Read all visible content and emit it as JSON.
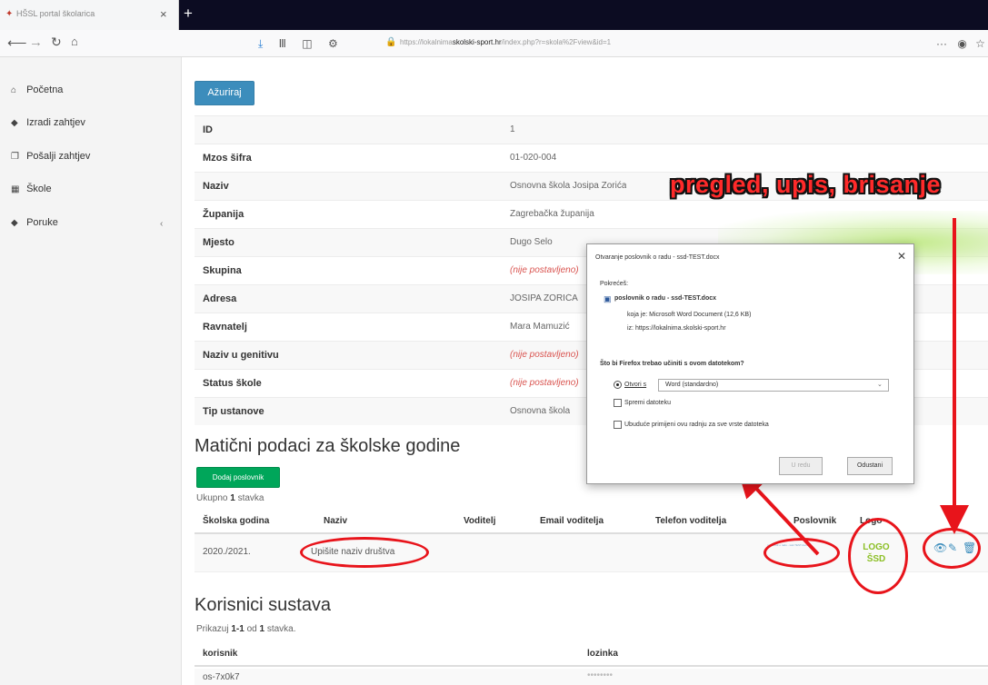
{
  "browser": {
    "tab_title": "HŠSL portal školarica",
    "url_prefix": "https://lokalnima",
    "url_domain": "skolski-sport.hr",
    "url_suffix": "/index.php?r=skola%2Fview&id=1",
    "overflow": "···"
  },
  "sidebar": {
    "items": [
      {
        "label": "Početna",
        "icon": "home-icon"
      },
      {
        "label": "Izradi zahtjev",
        "icon": "tag-icon"
      },
      {
        "label": "Pošalji zahtjev",
        "icon": "copy-icon"
      },
      {
        "label": "Škole",
        "icon": "building-icon"
      },
      {
        "label": "Poruke",
        "icon": "tag-icon"
      }
    ]
  },
  "main": {
    "update_button": "Ažuriraj",
    "details": [
      {
        "label": "ID",
        "value": "1",
        "notset": false
      },
      {
        "label": "Mzos šifra",
        "value": "01-020-004",
        "notset": false
      },
      {
        "label": "Naziv",
        "value": "Osnovna škola Josipa Zorića",
        "notset": false
      },
      {
        "label": "Županija",
        "value": "Zagrebačka županija",
        "notset": false
      },
      {
        "label": "Mjesto",
        "value": "Dugo Selo",
        "notset": false
      },
      {
        "label": "Skupina",
        "value": "(nije postavljeno)",
        "notset": true
      },
      {
        "label": "Adresa",
        "value": "JOSIPA ZORIĆA",
        "notset": false
      },
      {
        "label": "Ravnatelj",
        "value": "Mara Mamuzić",
        "notset": false
      },
      {
        "label": "Naziv u genitivu",
        "value": "(nije postavljeno)",
        "notset": true
      },
      {
        "label": "Status škole",
        "value": "(nije postavljeno)",
        "notset": true
      },
      {
        "label": "Tip ustanove",
        "value": "Osnovna škola",
        "notset": false
      }
    ],
    "school_years": {
      "title": "Matični podaci za školske godine",
      "add_button": "Dodaj poslovnik",
      "summary_prefix": "Ukupno",
      "summary_count": "1",
      "summary_suffix": "stavka",
      "columns": [
        "Školska godina",
        "Naziv",
        "Voditelj",
        "Email voditelja",
        "Telefon voditelja",
        "Poslovnik",
        "Logo"
      ],
      "rows": [
        {
          "year": "2020./2021.",
          "name": "Upišite naziv društva",
          "voditelj": "",
          "email": "",
          "phone": "",
          "poslovnik": "poslovnik o radu - ssd-TEST.docx",
          "logo_text": "LOGO ŠSD"
        }
      ]
    },
    "users": {
      "title": "Korisnici sustava",
      "summary_prefix": "Prikazuj",
      "summary_range": "1-1",
      "summary_mid": "od",
      "summary_count": "1",
      "summary_suffix": "stavka.",
      "columns": [
        "korisnik",
        "lozinka"
      ],
      "rows": [
        {
          "user": "os-7x0k7",
          "password": "••••••••"
        }
      ]
    }
  },
  "annotation": {
    "title": "pregled, upis, brisanje",
    "color": "#e8141b"
  },
  "dialog": {
    "title": "Otvaranje poslovnik o radu - ssd-TEST.docx",
    "opening_label": "Pokrećeš:",
    "filename": "poslovnik o radu - ssd-TEST.docx",
    "type_line": "koja je: Microsoft Word Document (12,6 KB)",
    "from_line": "iz: https://lokalnima.skolski-sport.hr",
    "question": "Što bi Firefox trebao učiniti s ovom datotekom?",
    "open_with_label": "Otvori s",
    "open_with_value": "Word (standardno)",
    "save_label": "Spremi datoteku",
    "remember_label": "Ubuduće primijeni ovu radnju za sve vrste datoteka",
    "ok_button": "U redu",
    "cancel_button": "Odustani"
  }
}
